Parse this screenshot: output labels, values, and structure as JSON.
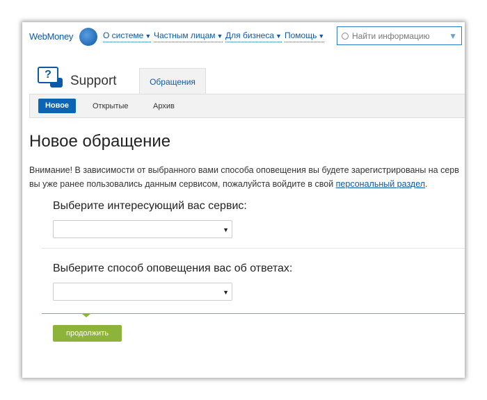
{
  "header": {
    "logo": "WebMoney",
    "nav": [
      {
        "label": "О системе"
      },
      {
        "label": "Частным лицам"
      },
      {
        "label": "Для бизнеса"
      },
      {
        "label": "Помощь"
      }
    ],
    "search_placeholder": "Найти информацию"
  },
  "support": {
    "title": "Support",
    "icon_text": "?",
    "tab": "Обращения",
    "subtabs": [
      "Новое",
      "Открытые",
      "Архив"
    ]
  },
  "main": {
    "heading": "Новое обращение",
    "notice": "Внимание! В зависимости от выбранного вами способа оповещения вы будете зарегистрированы на серв",
    "notice2": "вы уже ранее пользовались данным сервисом, пожалуйста войдите в свой ",
    "link": "персональный раздел",
    "period": ".",
    "label_service": "Выберите интересующий вас сервис:",
    "label_notify": "Выберите способ оповещения вас об ответах:",
    "service_value": "",
    "notify_value": "",
    "continue": "продолжить"
  }
}
